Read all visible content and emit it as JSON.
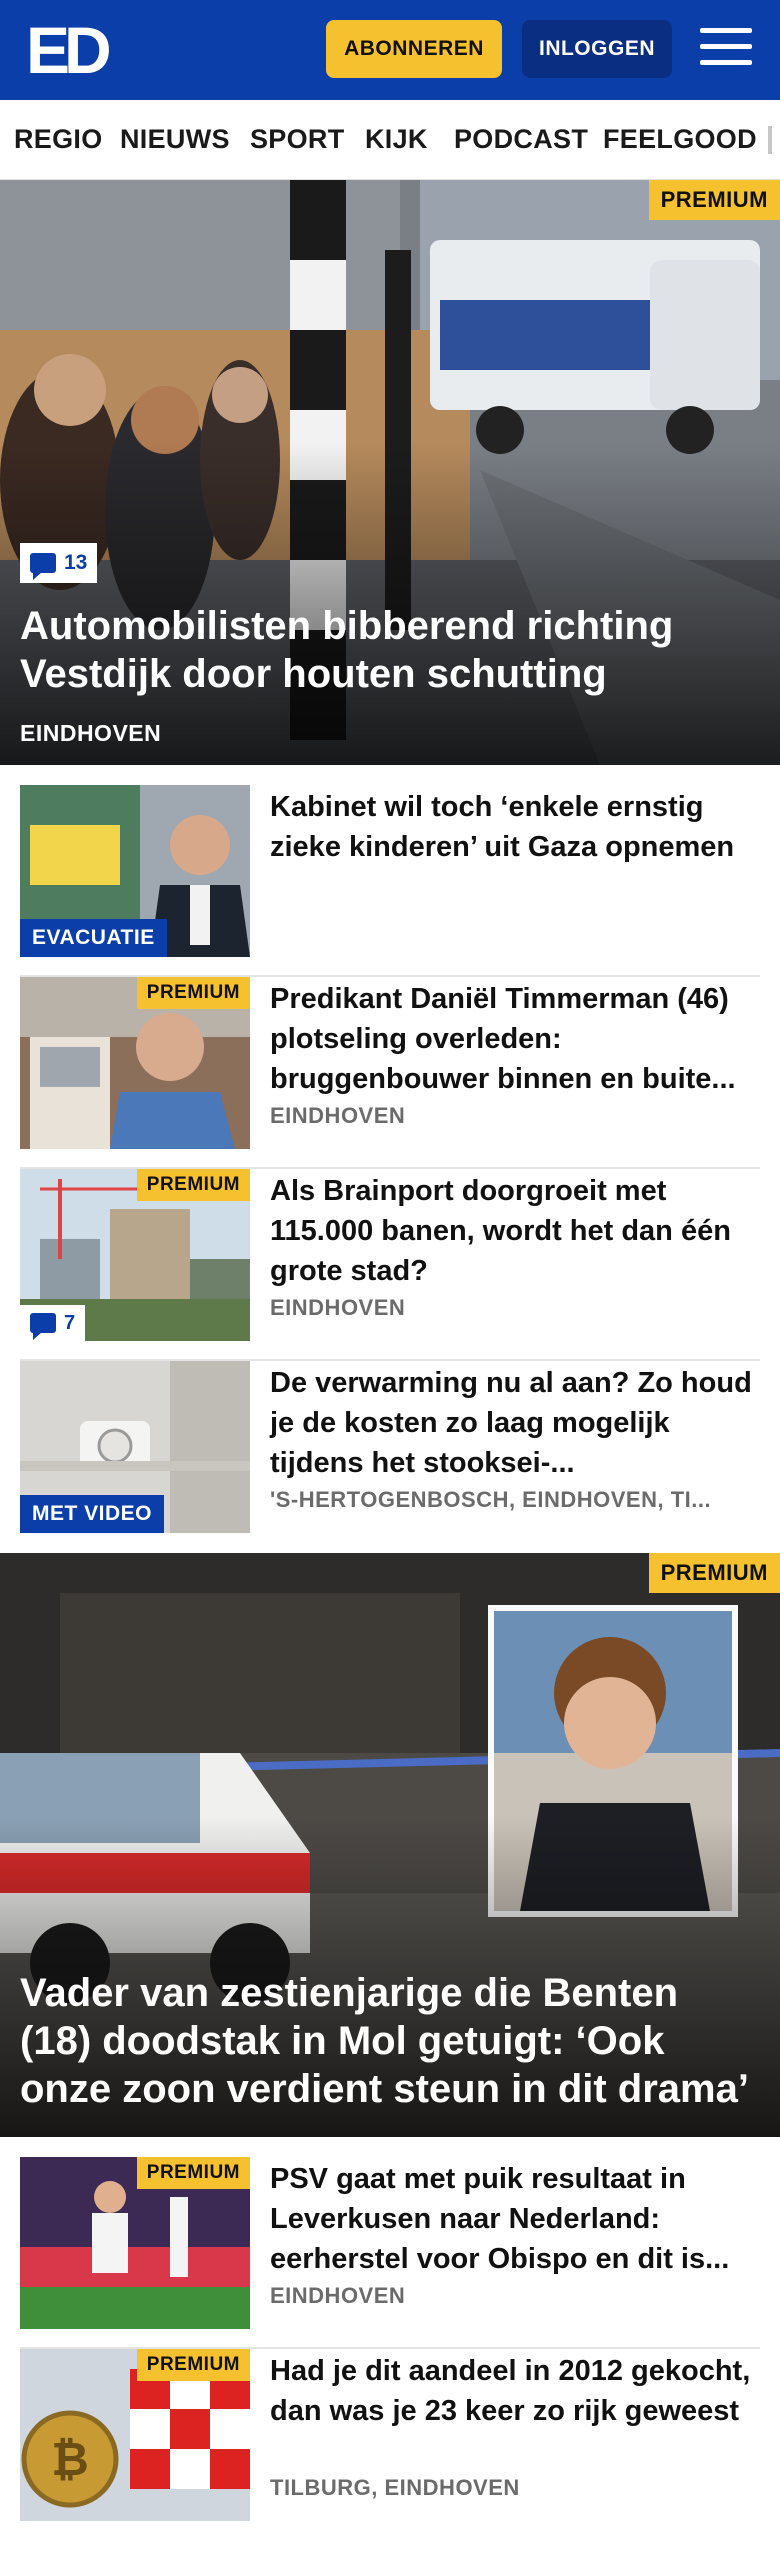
{
  "header": {
    "logo_text": "ED",
    "subscribe_label": "ABONNEREN",
    "login_label": "INLOGGEN",
    "menu_icon": "hamburger-menu-icon"
  },
  "nav": {
    "items": [
      "REGIO",
      "NIEUWS",
      "SPORT",
      "KIJK",
      "PODCAST",
      "FEELGOOD"
    ]
  },
  "colors": {
    "brand_blue": "#0b3ea8",
    "premium_yellow": "#f5c12e",
    "location_gray": "#6b6b6b"
  },
  "hero1": {
    "premium": "PREMIUM",
    "comments": "13",
    "title": "Automobilisten bibberend richting Vestdijk door houten schutting",
    "location": "EINDHOVEN"
  },
  "rows": [
    {
      "label": "EVACUATIE",
      "title": "Kabinet wil toch ‘enkele ernstig zieke kinderen’ uit Gaza opnemen",
      "location": ""
    },
    {
      "premium": "PREMIUM",
      "title": "Predikant Daniël Timmerman (46) plotseling overleden: bruggenbouwer binnen en buite...",
      "location": "EINDHOVEN"
    },
    {
      "premium": "PREMIUM",
      "comments": "7",
      "title": "Als Brainport doorgroeit met 115.000 banen, wordt het dan één grote stad?",
      "location": "EINDHOVEN"
    },
    {
      "label": "MET VIDEO",
      "title": "De verwarming nu al aan? Zo houd je de kosten zo laag mogelijk tijdens het stooksei-...",
      "location": "'S-HERTOGENBOSCH, EINDHOVEN, TI..."
    }
  ],
  "hero2": {
    "premium": "PREMIUM",
    "title": "Vader van zestienjarige die Benten (18) doodstak in Mol getuigt: ‘Ook onze zoon verdient steun in dit drama’"
  },
  "rows2": [
    {
      "premium": "PREMIUM",
      "title": "PSV gaat met puik resultaat in Leverkusen naar Nederland: eerherstel voor Obispo en dit is...",
      "location": "EINDHOVEN"
    },
    {
      "premium": "PREMIUM",
      "title": "Had je dit aandeel in 2012 gekocht, dan was je 23 keer zo rijk geweest",
      "location": "TILBURG, EINDHOVEN"
    }
  ]
}
